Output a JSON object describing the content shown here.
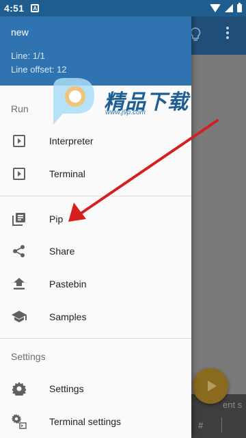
{
  "status_bar": {
    "time": "4:51",
    "notification_icon": "A"
  },
  "drawer": {
    "header": {
      "file_name": "new",
      "line": "Line: 1/1",
      "line_offset": "Line offset: 12"
    },
    "sections": {
      "run": {
        "label": "Run"
      },
      "settings": {
        "label": "Settings"
      }
    },
    "items": [
      {
        "label": "Interpreter",
        "icon": "play-box-icon"
      },
      {
        "label": "Terminal",
        "icon": "play-box-icon"
      },
      {
        "label": "Pip",
        "icon": "library-books-icon"
      },
      {
        "label": "Share",
        "icon": "share-icon"
      },
      {
        "label": "Pastebin",
        "icon": "upload-icon"
      },
      {
        "label": "Samples",
        "icon": "school-icon"
      },
      {
        "label": "Settings",
        "icon": "gear-icon"
      },
      {
        "label": "Terminal settings",
        "icon": "terminal-settings-icon"
      }
    ]
  },
  "background": {
    "bottom_hash": "#",
    "bottom_text": "ent s"
  },
  "watermark": {
    "text": "精品下载",
    "url": "www.j9p.com"
  },
  "colors": {
    "header": "#2f73b0",
    "toolbar": "#1f4f78",
    "arrow": "#d61f1f",
    "fab": "#8a6a1e"
  }
}
